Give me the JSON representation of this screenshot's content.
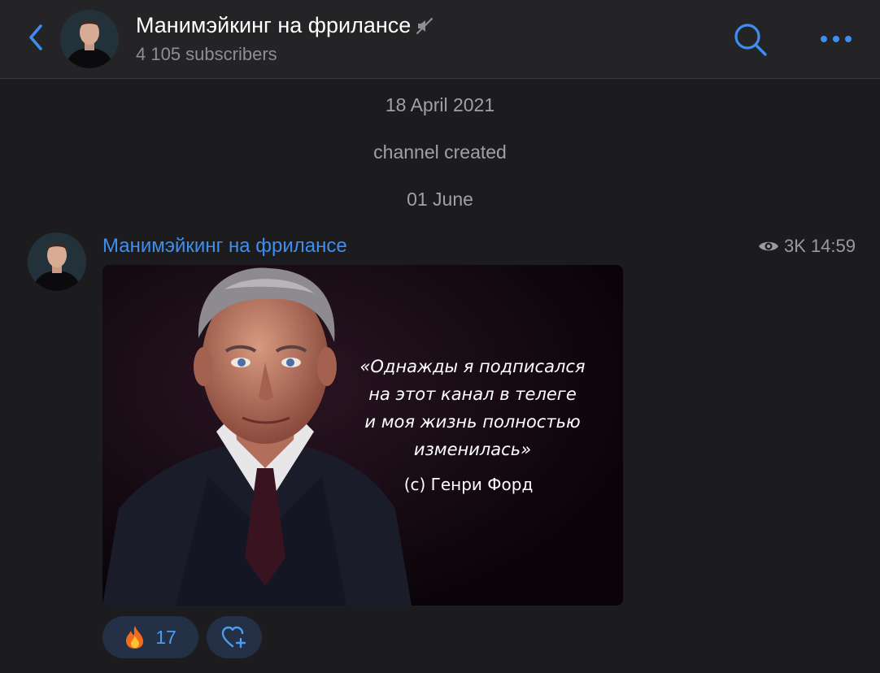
{
  "header": {
    "back_icon": "chevron-left-icon",
    "title": "Манимэйкинг на фрилансе",
    "muted_icon": "muted-speaker-icon",
    "subscribers": "4 105 subscribers",
    "search_icon": "search-icon",
    "more_icon": "more-dots-icon",
    "accent_color": "#3e8eef"
  },
  "service_messages": {
    "date_1": "18 April 2021",
    "created": "channel created",
    "date_2": "01 June"
  },
  "message": {
    "sender": "Манимэйкинг на фрилансе",
    "views": "3K",
    "time": "14:59",
    "photo": {
      "quote_lines": [
        "«Однажды я подписался",
        "на этот канал в телеге",
        "и моя жизнь полностью",
        "изменилась»"
      ],
      "author": "(с) Генри Форд"
    },
    "reactions": [
      {
        "emoji": "fire-emoji",
        "count": "17"
      }
    ],
    "add_reaction_icon": "add-reaction-heart-icon"
  }
}
